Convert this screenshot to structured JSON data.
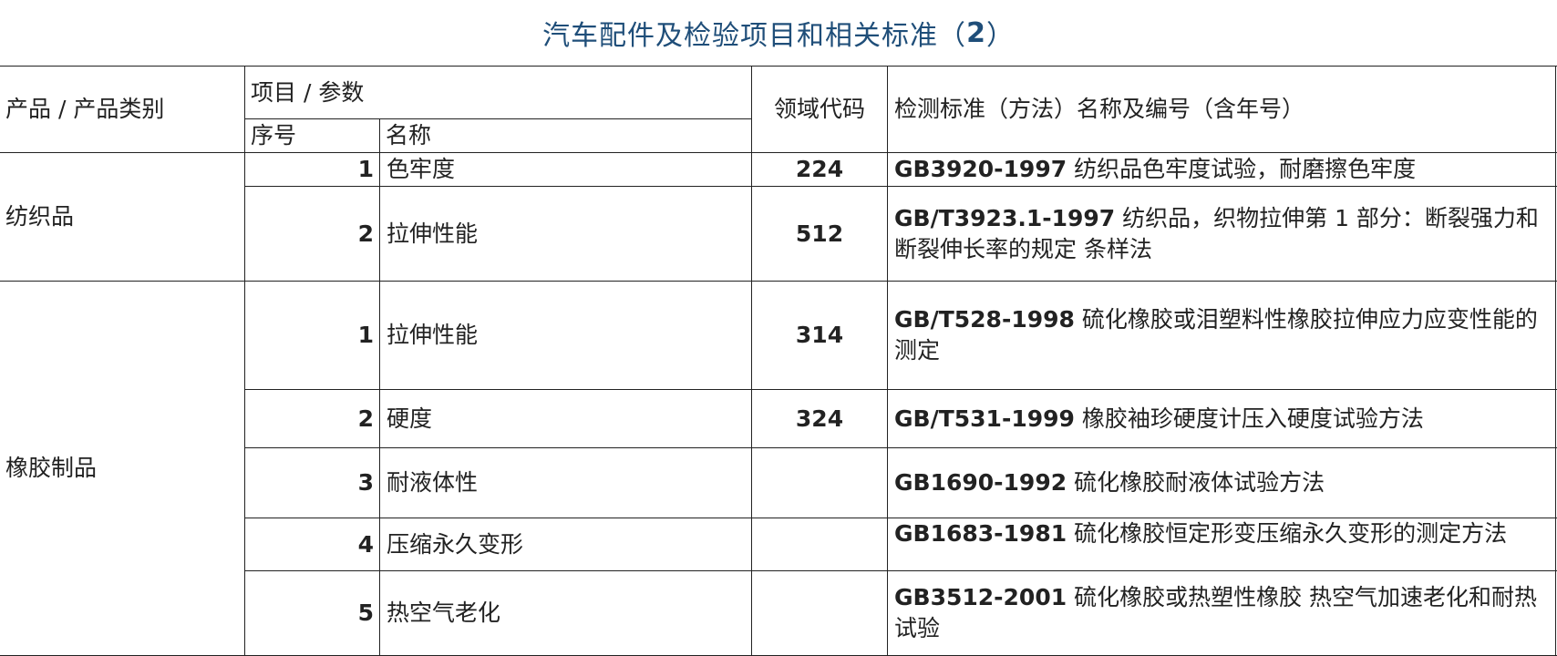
{
  "title": {
    "text": "汽车配件及检验项目和相关标准（",
    "num": "2",
    "close": "）"
  },
  "header": {
    "product": "产品 / 产品类别",
    "item_param": "项目 / 参数",
    "seq": "序号",
    "name": "名称",
    "field_code": "领域代码",
    "standard": "检测标准（方法）名称及编号（含年号）"
  },
  "groups": [
    {
      "category": "纺织品",
      "rows": [
        {
          "seq": "1",
          "name": "色牢度",
          "code": "224",
          "std_code": "GB3920-1997",
          "std_text": " 纺织品色牢度试验，耐磨擦色牢度"
        },
        {
          "seq": "2",
          "name": "拉伸性能",
          "code": "512",
          "std_code": "GB/T3923.1-1997",
          "std_text": " 纺织品，织物拉伸第 1 部分：断裂强力和断裂伸长率的规定 条样法"
        }
      ]
    },
    {
      "category": "橡胶制品",
      "rows": [
        {
          "seq": "1",
          "name": "拉伸性能",
          "code": "314",
          "std_code": "GB/T528-1998",
          "std_text": " 硫化橡胶或泪塑料性橡胶拉伸应力应变性能的测定"
        },
        {
          "seq": "2",
          "name": "硬度",
          "code": "324",
          "std_code": "GB/T531-1999",
          "std_text": " 橡胶袖珍硬度计压入硬度试验方法"
        },
        {
          "seq": "3",
          "name": "耐液体性",
          "code": "",
          "std_code": "GB1690-1992",
          "std_text": " 硫化橡胶耐液体试验方法"
        },
        {
          "seq": "4",
          "name": "压缩永久变形",
          "code": "",
          "std_code": "GB1683-1981",
          "std_text": " 硫化橡胶恒定形变压缩永久变形的测定方法"
        },
        {
          "seq": "5",
          "name": "热空气老化",
          "code": "",
          "std_code": "GB3512-2001",
          "std_text": " 硫化橡胶或热塑性橡胶 热空气加速老化和耐热试验"
        }
      ]
    }
  ]
}
